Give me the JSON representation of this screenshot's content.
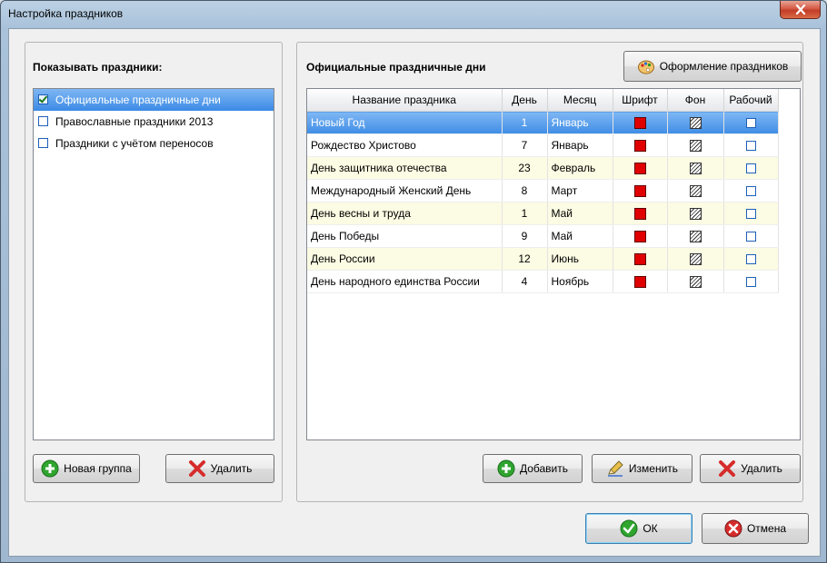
{
  "window": {
    "title": "Настройка праздников"
  },
  "left_panel": {
    "title": "Показывать праздники:",
    "items": [
      {
        "label": "Официальные праздничные дни",
        "checked": true,
        "selected": true
      },
      {
        "label": "Православные праздники 2013",
        "checked": false,
        "selected": false
      },
      {
        "label": "Праздники с учётом переносов",
        "checked": false,
        "selected": false
      }
    ],
    "new_group_label": "Новая группа",
    "delete_label": "Удалить"
  },
  "right_panel": {
    "title": "Официальные праздничные дни",
    "design_button_label": "Оформление праздников",
    "columns": [
      "Название праздника",
      "День",
      "Месяц",
      "Шрифт",
      "Фон",
      "Рабочий"
    ],
    "rows": [
      {
        "name": "Новый Год",
        "day": "1",
        "month": "Январь",
        "working": false
      },
      {
        "name": "Рождество Христово",
        "day": "7",
        "month": "Январь",
        "working": false
      },
      {
        "name": "День защитника отечества",
        "day": "23",
        "month": "Февраль",
        "working": false
      },
      {
        "name": "Международный Женский День",
        "day": "8",
        "month": "Март",
        "working": false
      },
      {
        "name": "День весны и труда",
        "day": "1",
        "month": "Май",
        "working": false
      },
      {
        "name": "День Победы",
        "day": "9",
        "month": "Май",
        "working": false
      },
      {
        "name": "День России",
        "day": "12",
        "month": "Июнь",
        "working": false
      },
      {
        "name": "День народного единства России",
        "day": "4",
        "month": "Ноябрь",
        "working": false
      }
    ],
    "add_label": "Добавить",
    "edit_label": "Изменить",
    "delete_label": "Удалить"
  },
  "footer": {
    "ok_label": "ОК",
    "cancel_label": "Отмена"
  },
  "colors": {
    "font_swatch": "#e00000",
    "selection": "#3b8ae6",
    "alt_row": "#fcfbe3"
  }
}
